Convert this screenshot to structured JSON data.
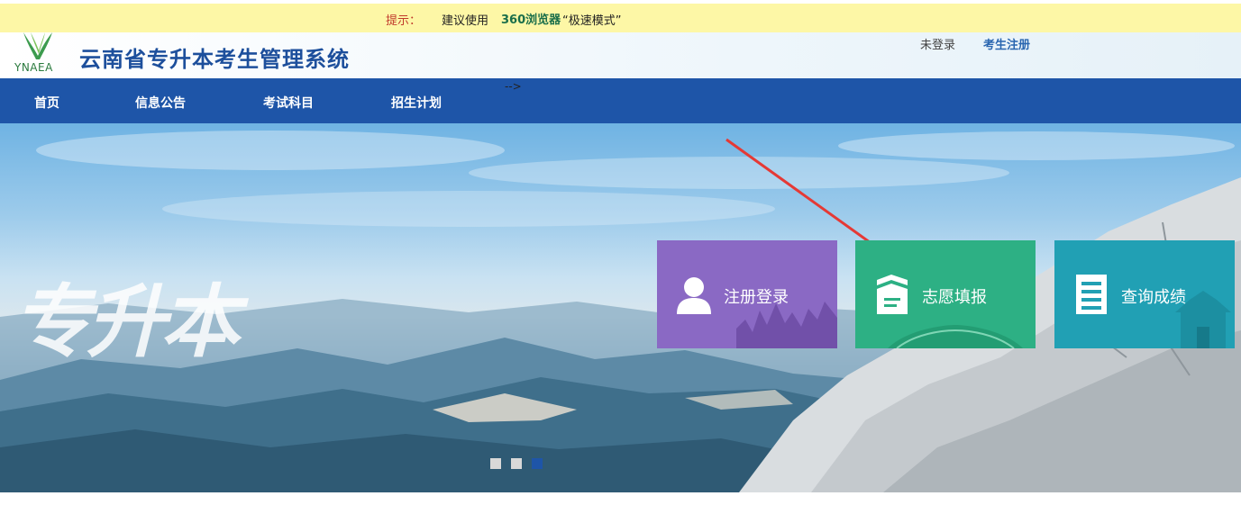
{
  "notice": {
    "label": "提示：",
    "text": "建议使用",
    "browser": "360浏览器",
    "mode": "“极速模式”"
  },
  "header": {
    "logo_text": "YNAEA",
    "title": "云南省专升本考生管理系统",
    "login_status": "未登录",
    "register_link": "考生注册"
  },
  "nav": {
    "items": [
      {
        "label": "首页"
      },
      {
        "label": "信息公告"
      },
      {
        "label": "考试科目"
      },
      {
        "label": "招生计划"
      }
    ],
    "stray_text": "-->"
  },
  "banner": {
    "calligraphy": "专升本",
    "tiles": [
      {
        "label": "注册登录",
        "icon": "user-icon"
      },
      {
        "label": "志愿填报",
        "icon": "application-form-icon"
      },
      {
        "label": "查询成绩",
        "icon": "document-list-icon"
      }
    ],
    "slides_count": 3,
    "active_slide": 3
  },
  "colors": {
    "nav_bg": "#1e55a8",
    "notice_bg": "#fdf7a6",
    "tile_register": "#8a69c4",
    "tile_choice": "#2db084",
    "tile_score": "#21a0b4",
    "arrow": "#e53935"
  }
}
